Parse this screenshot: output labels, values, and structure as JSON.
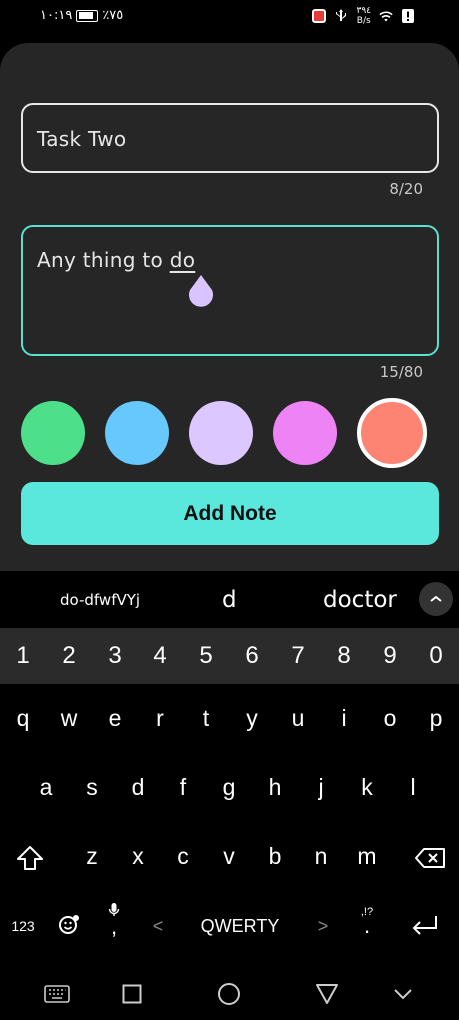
{
  "status_bar": {
    "time": "١٠:١٩",
    "battery": "٪٧٥",
    "speed_value": "٣٩٤",
    "speed_unit": "B/s"
  },
  "note_form": {
    "title_value": "Task Two",
    "title_counter": "8/20",
    "body_value_prefix": "Any thing to ",
    "body_value_word": "do",
    "body_counter": "15/80",
    "colors": [
      "#4ddf8a",
      "#66c8fc",
      "#ddc7ff",
      "#ee83f5",
      "#fd8473"
    ],
    "selected_color_index": 4,
    "add_button_label": "Add Note"
  },
  "keyboard": {
    "suggestions": [
      "do-dfwfVYj",
      "d",
      "doctor"
    ],
    "number_row": [
      "1",
      "2",
      "3",
      "4",
      "5",
      "6",
      "7",
      "8",
      "9",
      "0"
    ],
    "row1": [
      "q",
      "w",
      "e",
      "r",
      "t",
      "y",
      "u",
      "i",
      "o",
      "p"
    ],
    "row2": [
      "a",
      "s",
      "d",
      "f",
      "g",
      "h",
      "j",
      "k",
      "l"
    ],
    "row3": [
      "z",
      "x",
      "c",
      "v",
      "b",
      "n",
      "m"
    ],
    "symbols_key": "123",
    "comma_key": ",",
    "layout_label": "QWERTY",
    "left_arrow": "<",
    "right_arrow": ">",
    "punct_key_top": ",!?",
    "period_key": "."
  }
}
